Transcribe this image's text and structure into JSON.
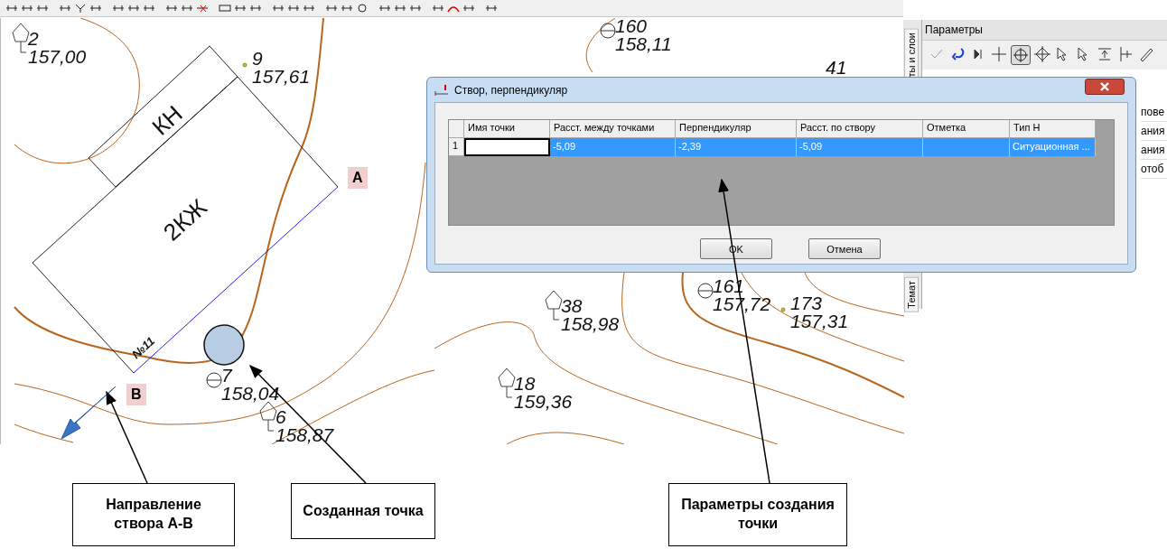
{
  "map": {
    "points": [
      {
        "kind": "tree",
        "number": "2",
        "elevation": "157,00"
      },
      {
        "kind": "dot",
        "number": "9",
        "elevation": "157,61"
      },
      {
        "kind": "manhole",
        "number": "160",
        "elevation": "158,11"
      },
      {
        "kind": "label",
        "number": "41"
      },
      {
        "kind": "manhole",
        "number": "161",
        "elevation": "157,72"
      },
      {
        "kind": "dot",
        "number": "173",
        "elevation": "157,31"
      },
      {
        "kind": "tree",
        "number": "38",
        "elevation": "158,98"
      },
      {
        "kind": "tree",
        "number": "18",
        "elevation": "159,36"
      },
      {
        "kind": "manhole",
        "number": "7",
        "elevation": "158,04"
      },
      {
        "kind": "tree",
        "number": "6",
        "elevation": "158,87"
      }
    ],
    "building": {
      "main_label": "2КЖ",
      "annex_label": "КН",
      "number": "№11"
    },
    "markers": [
      "A",
      "B"
    ]
  },
  "dialog": {
    "title": "Створ, перпендикуляр",
    "columns": [
      "Имя точки",
      "Расст. между точками",
      "Перпендикуляр",
      "Расст. по створу",
      "Отметка",
      "Тип Н"
    ],
    "rows": [
      {
        "index": "1",
        "selected": true,
        "cells": [
          "",
          "-5,09",
          "-2,39",
          "-5,09",
          "",
          "Ситуационная ..."
        ]
      }
    ],
    "buttons": [
      "OK",
      "Отмена"
    ]
  },
  "side_panel": {
    "title": "Параметры",
    "tabs": [
      "ты и слои",
      "Темат"
    ],
    "tools": [
      {
        "kind": "check",
        "selected": false
      },
      {
        "kind": "undo",
        "selected": false
      },
      {
        "kind": "step",
        "selected": false
      },
      {
        "kind": "plus",
        "selected": false
      },
      {
        "kind": "target",
        "selected": true
      },
      {
        "kind": "diamond",
        "selected": false
      },
      {
        "kind": "cursor",
        "selected": false
      },
      {
        "kind": "cursor",
        "selected": false
      },
      {
        "kind": "node",
        "selected": false
      },
      {
        "kind": "ruler",
        "selected": false
      },
      {
        "kind": "pen",
        "selected": false
      }
    ],
    "rows": [
      "пове",
      "ания",
      "ания",
      "отоб"
    ]
  },
  "callouts": [
    "Направление створа А-В",
    "Созданная точка",
    "Параметры создания точки"
  ]
}
